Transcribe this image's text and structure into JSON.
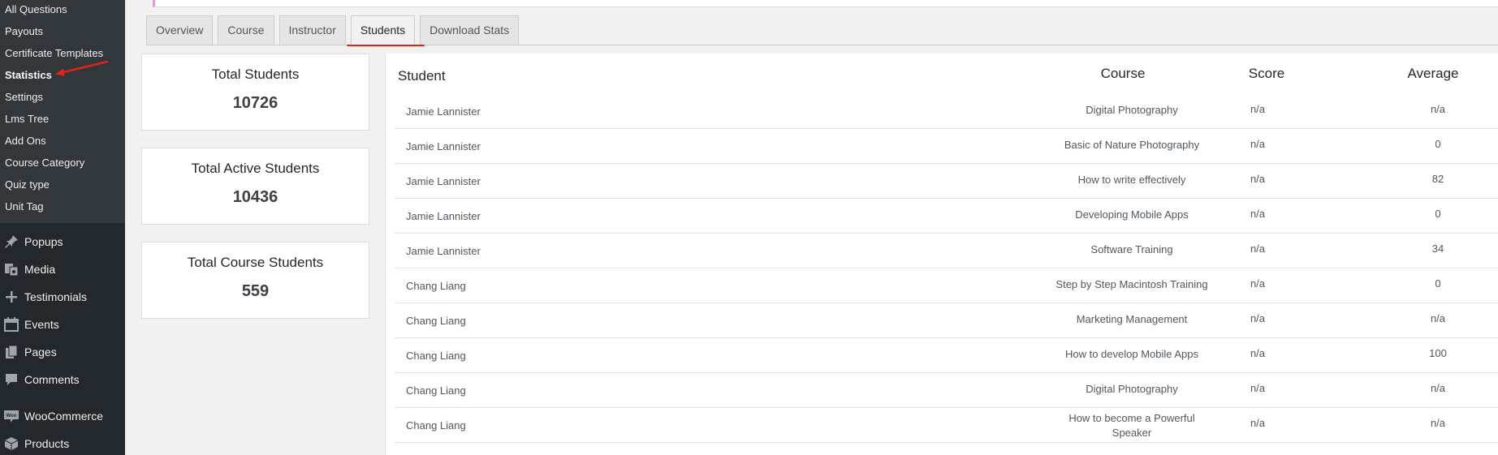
{
  "sidebar": {
    "submenu": [
      {
        "label": "All Questions"
      },
      {
        "label": "Payouts"
      },
      {
        "label": "Certificate Templates"
      },
      {
        "label": "Statistics"
      },
      {
        "label": "Settings"
      },
      {
        "label": "Lms Tree"
      },
      {
        "label": "Add Ons"
      },
      {
        "label": "Course Category"
      },
      {
        "label": "Quiz type"
      },
      {
        "label": "Unit Tag"
      }
    ],
    "menu": [
      {
        "label": "Popups",
        "icon": "pin-icon"
      },
      {
        "label": "Media",
        "icon": "media-icon"
      },
      {
        "label": "Testimonials",
        "icon": "plus-icon"
      },
      {
        "label": "Events",
        "icon": "calendar-icon"
      },
      {
        "label": "Pages",
        "icon": "pages-icon"
      },
      {
        "label": "Comments",
        "icon": "comment-icon"
      },
      {
        "label": "WooCommerce",
        "icon": "woocommerce-icon"
      },
      {
        "label": "Products",
        "icon": "box-icon"
      }
    ],
    "woo_icon_text": "Woo"
  },
  "tabs": [
    {
      "label": "Overview"
    },
    {
      "label": "Course"
    },
    {
      "label": "Instructor"
    },
    {
      "label": "Students"
    },
    {
      "label": "Download Stats"
    }
  ],
  "cards": [
    {
      "title": "Total Students",
      "value": "10726"
    },
    {
      "title": "Total Active Students",
      "value": "10436"
    },
    {
      "title": "Total Course Students",
      "value": "559"
    }
  ],
  "table": {
    "headers": {
      "student": "Student",
      "course": "Course",
      "score": "Score",
      "average": "Average"
    },
    "rows": [
      {
        "student": "Jamie Lannister",
        "course": "Digital Photography",
        "score": "n/a",
        "average": "n/a"
      },
      {
        "student": "Jamie Lannister",
        "course": "Basic of Nature Photography",
        "score": "n/a",
        "average": "0"
      },
      {
        "student": "Jamie Lannister",
        "course": "How to write effectively",
        "score": "n/a",
        "average": "82"
      },
      {
        "student": "Jamie Lannister",
        "course": "Developing Mobile Apps",
        "score": "n/a",
        "average": "0"
      },
      {
        "student": "Jamie Lannister",
        "course": "Software Training",
        "score": "n/a",
        "average": "34"
      },
      {
        "student": "Chang Liang",
        "course": "Step by Step Macintosh Training",
        "score": "n/a",
        "average": "0"
      },
      {
        "student": "Chang Liang",
        "course": "Marketing Management",
        "score": "n/a",
        "average": "n/a"
      },
      {
        "student": "Chang Liang",
        "course": "How to develop Mobile Apps",
        "score": "n/a",
        "average": "100"
      },
      {
        "student": "Chang Liang",
        "course": "Digital Photography",
        "score": "n/a",
        "average": "n/a"
      },
      {
        "student": "Chang Liang",
        "course": "How to become a Powerful Speaker",
        "score": "n/a",
        "average": "n/a"
      }
    ]
  },
  "colors": {
    "sidebar_bg": "#23282d",
    "submenu_bg": "#32373c",
    "annotation_red": "#e2231a",
    "topbar_accent": "#d6a3d1"
  }
}
